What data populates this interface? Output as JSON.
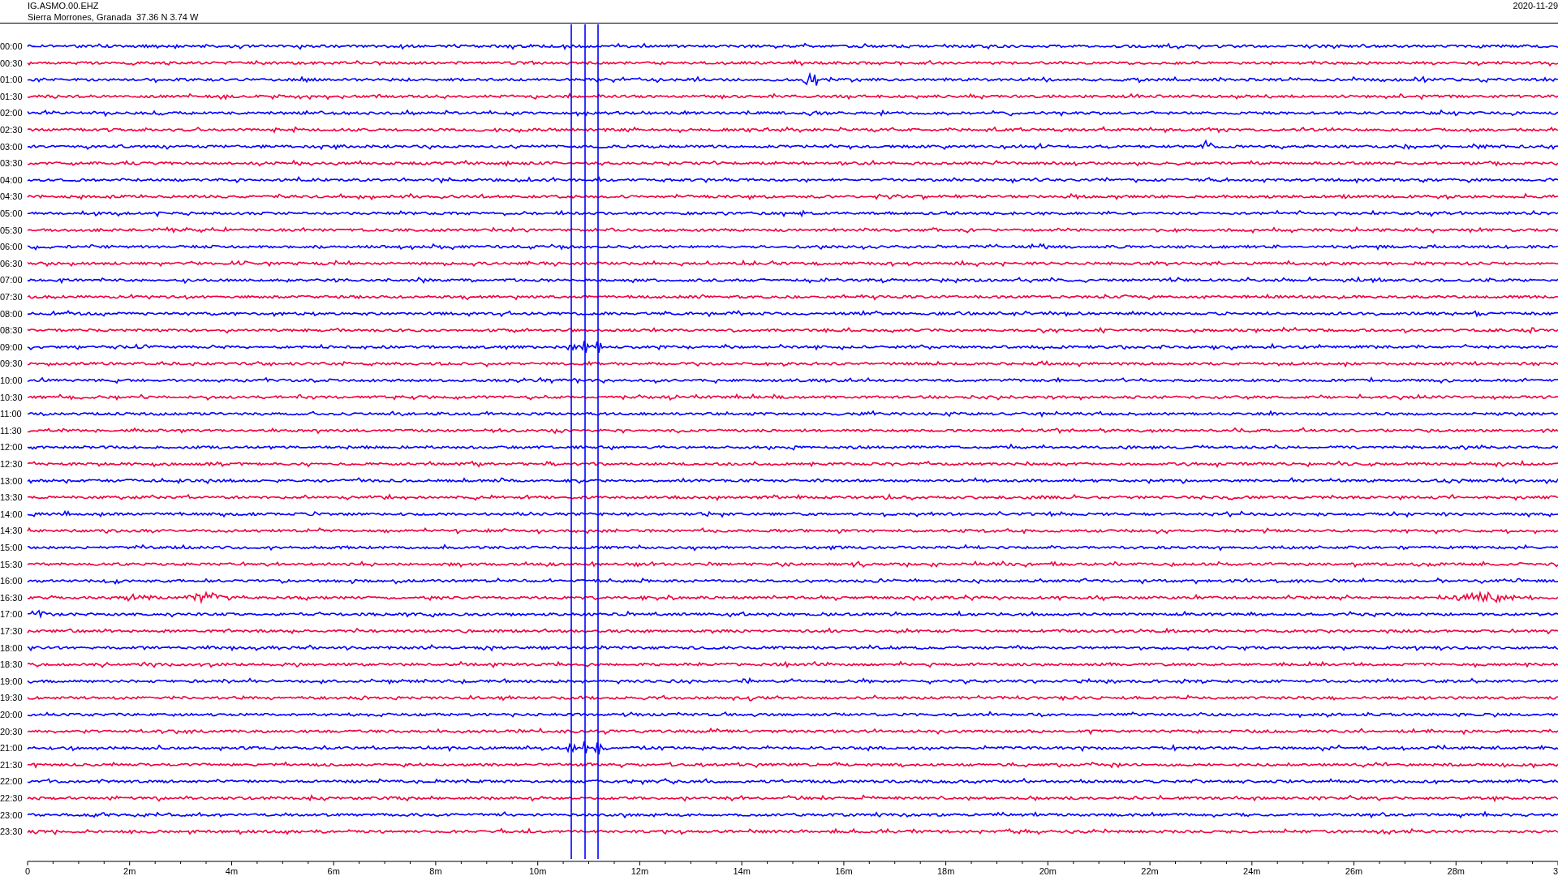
{
  "header": {
    "station": "IG.ASMO.00.EHZ",
    "location": "Sierra Morrones, Granada  37.36 N 3.74 W",
    "date": "2020-11-29"
  },
  "rows": [
    {
      "label": "00:00",
      "color": "#0000ff"
    },
    {
      "label": "00:30",
      "color": "#f0003c"
    },
    {
      "label": "01:00",
      "color": "#0000ff"
    },
    {
      "label": "01:30",
      "color": "#f0003c"
    },
    {
      "label": "02:00",
      "color": "#0000ff"
    },
    {
      "label": "02:30",
      "color": "#f0003c"
    },
    {
      "label": "03:00",
      "color": "#0000ff"
    },
    {
      "label": "03:30",
      "color": "#f0003c"
    },
    {
      "label": "04:00",
      "color": "#0000ff"
    },
    {
      "label": "04:30",
      "color": "#f0003c"
    },
    {
      "label": "05:00",
      "color": "#0000ff"
    },
    {
      "label": "05:30",
      "color": "#f0003c"
    },
    {
      "label": "06:00",
      "color": "#0000ff"
    },
    {
      "label": "06:30",
      "color": "#f0003c"
    },
    {
      "label": "07:00",
      "color": "#0000ff"
    },
    {
      "label": "07:30",
      "color": "#f0003c"
    },
    {
      "label": "08:00",
      "color": "#0000ff"
    },
    {
      "label": "08:30",
      "color": "#f0003c"
    },
    {
      "label": "09:00",
      "color": "#0000ff"
    },
    {
      "label": "09:30",
      "color": "#f0003c"
    },
    {
      "label": "10:00",
      "color": "#0000ff"
    },
    {
      "label": "10:30",
      "color": "#f0003c"
    },
    {
      "label": "11:00",
      "color": "#0000ff"
    },
    {
      "label": "11:30",
      "color": "#f0003c"
    },
    {
      "label": "12:00",
      "color": "#0000ff"
    },
    {
      "label": "12:30",
      "color": "#f0003c"
    },
    {
      "label": "13:00",
      "color": "#0000ff"
    },
    {
      "label": "13:30",
      "color": "#f0003c"
    },
    {
      "label": "14:00",
      "color": "#0000ff"
    },
    {
      "label": "14:30",
      "color": "#f0003c"
    },
    {
      "label": "15:00",
      "color": "#0000ff"
    },
    {
      "label": "15:30",
      "color": "#f0003c"
    },
    {
      "label": "16:00",
      "color": "#0000ff"
    },
    {
      "label": "16:30",
      "color": "#f0003c"
    },
    {
      "label": "17:00",
      "color": "#0000ff"
    },
    {
      "label": "17:30",
      "color": "#f0003c"
    },
    {
      "label": "18:00",
      "color": "#0000ff"
    },
    {
      "label": "18:30",
      "color": "#f0003c"
    },
    {
      "label": "19:00",
      "color": "#0000ff"
    },
    {
      "label": "19:30",
      "color": "#f0003c"
    },
    {
      "label": "20:00",
      "color": "#0000ff"
    },
    {
      "label": "20:30",
      "color": "#f0003c"
    },
    {
      "label": "21:00",
      "color": "#0000ff"
    },
    {
      "label": "21:30",
      "color": "#f0003c"
    },
    {
      "label": "22:00",
      "color": "#0000ff"
    },
    {
      "label": "22:30",
      "color": "#f0003c"
    },
    {
      "label": "23:00",
      "color": "#0000ff"
    },
    {
      "label": "23:30",
      "color": "#f0003c"
    }
  ],
  "axis": {
    "ticks": [
      "0",
      "2m",
      "4m",
      "6m",
      "8m",
      "10m",
      "12m",
      "14m",
      "16m",
      "18m",
      "20m",
      "22m",
      "24m",
      "26m",
      "28m",
      "3"
    ]
  }
}
